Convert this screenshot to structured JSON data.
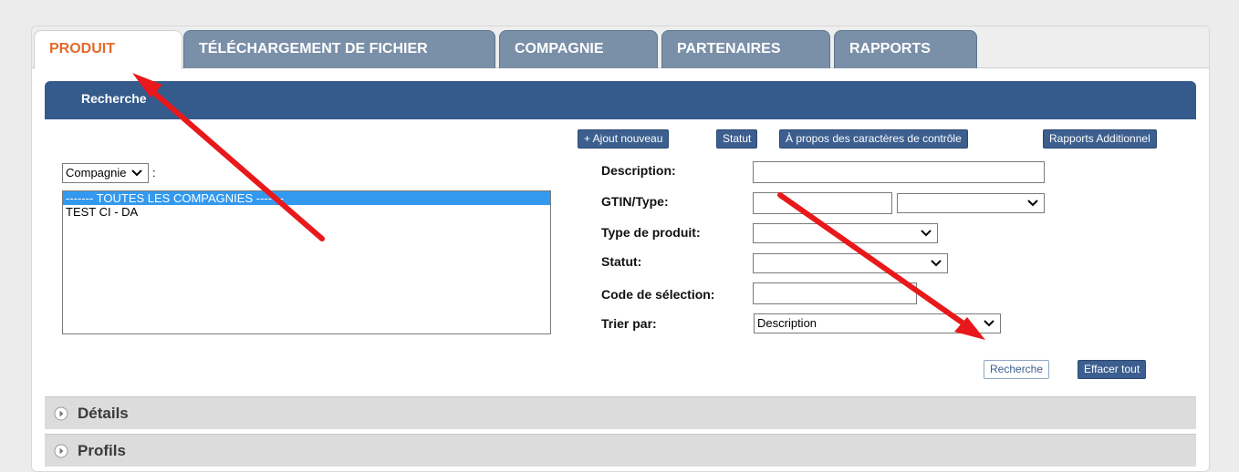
{
  "tabs": [
    {
      "label": "PRODUIT",
      "active": true
    },
    {
      "label": "TÉLÉCHARGEMENT DE FICHIER",
      "active": false
    },
    {
      "label": "COMPAGNIE",
      "active": false
    },
    {
      "label": "PARTENAIRES",
      "active": false
    },
    {
      "label": "RAPPORTS",
      "active": false
    }
  ],
  "search_band": {
    "title": "Recherche"
  },
  "toolbar": {
    "add_new": "+ Ajout nouveau",
    "status": "Statut",
    "about_check_chars": "À propos des caractères de contrôle",
    "additional_reports": "Rapports Additionnel"
  },
  "filter": {
    "selected": "Compagnie",
    "suffix": ":"
  },
  "company_list": [
    {
      "label": "------- TOUTES LES COMPAGNIES -------",
      "selected": true
    },
    {
      "label": "TEST CI - DA",
      "selected": false
    }
  ],
  "form": {
    "description_label": "Description:",
    "description_value": "",
    "gtin_label": "GTIN/Type:",
    "gtin_value": "",
    "gtin_type_value": "",
    "product_type_label": "Type de produit:",
    "product_type_value": "",
    "status_label": "Statut:",
    "status_value": "",
    "selection_code_label": "Code de sélection:",
    "selection_code_value": "",
    "sort_label": "Trier par:",
    "sort_value": "Description"
  },
  "actions": {
    "search": "Recherche",
    "clear_all": "Effacer tout"
  },
  "sections": [
    {
      "label": "Détails"
    },
    {
      "label": "Profils"
    }
  ],
  "colors": {
    "accent_orange": "#e36a2a",
    "tab_blue_gray": "#7a8fa8",
    "band_blue": "#355b8c",
    "button_blue": "#3c5f8f",
    "selection_blue": "#3399ee",
    "annotation_red": "#e8181b"
  }
}
